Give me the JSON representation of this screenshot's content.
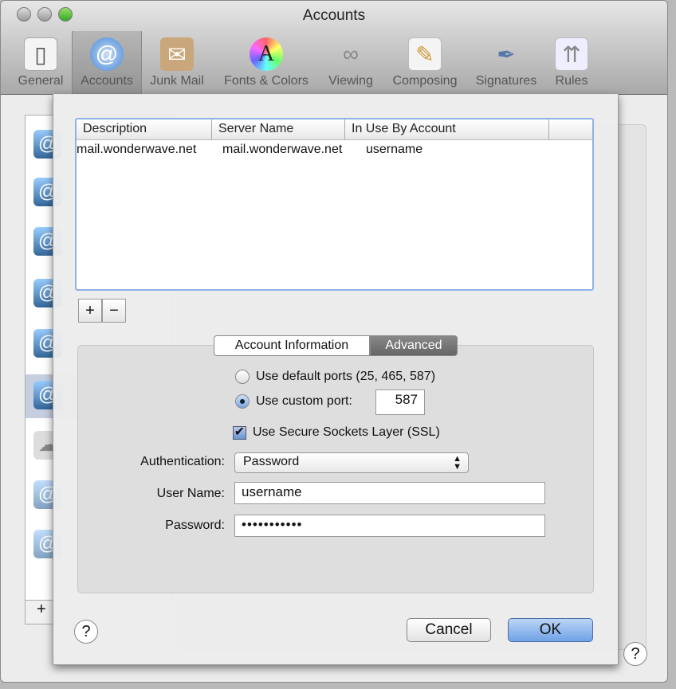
{
  "window": {
    "title": "Accounts"
  },
  "toolbar": [
    {
      "label": "General",
      "icon": "switch-icon"
    },
    {
      "label": "Accounts",
      "icon": "at-icon",
      "selected": true
    },
    {
      "label": "Junk Mail",
      "icon": "junk-bag-icon"
    },
    {
      "label": "Fonts & Colors",
      "icon": "fonts-colors-icon"
    },
    {
      "label": "Viewing",
      "icon": "viewing-glasses-icon"
    },
    {
      "label": "Composing",
      "icon": "pencil-paper-icon"
    },
    {
      "label": "Signatures",
      "icon": "pen-signature-icon"
    },
    {
      "label": "Rules",
      "icon": "rules-arrows-icon"
    }
  ],
  "server_table": {
    "columns": [
      "Description",
      "Server Name",
      "In Use By Account"
    ],
    "rows": [
      [
        "mail.wonderwave.net",
        "mail.wonderwave.net",
        "username"
      ]
    ]
  },
  "list_buttons": {
    "add": "+",
    "remove": "−"
  },
  "tabs": [
    {
      "label": "Account Information"
    },
    {
      "label": "Advanced",
      "selected": true
    }
  ],
  "advanced": {
    "default_ports_label": "Use default ports (25, 465, 587)",
    "custom_port_label": "Use custom port:",
    "port_mode": "custom",
    "custom_port": "587",
    "ssl_label": "Use Secure Sockets Layer (SSL)",
    "ssl_checked": true,
    "auth_label": "Authentication:",
    "auth_value": "Password",
    "username_label": "User Name:",
    "username_value": "username",
    "password_label": "Password:",
    "password_value": "•••••••••••"
  },
  "buttons": {
    "help": "?",
    "cancel": "Cancel",
    "ok": "OK"
  },
  "background": {
    "add": "+",
    "help": "?"
  },
  "colors": {
    "accent": "#6fa2e6",
    "selection_border": "#8fb2e6"
  }
}
